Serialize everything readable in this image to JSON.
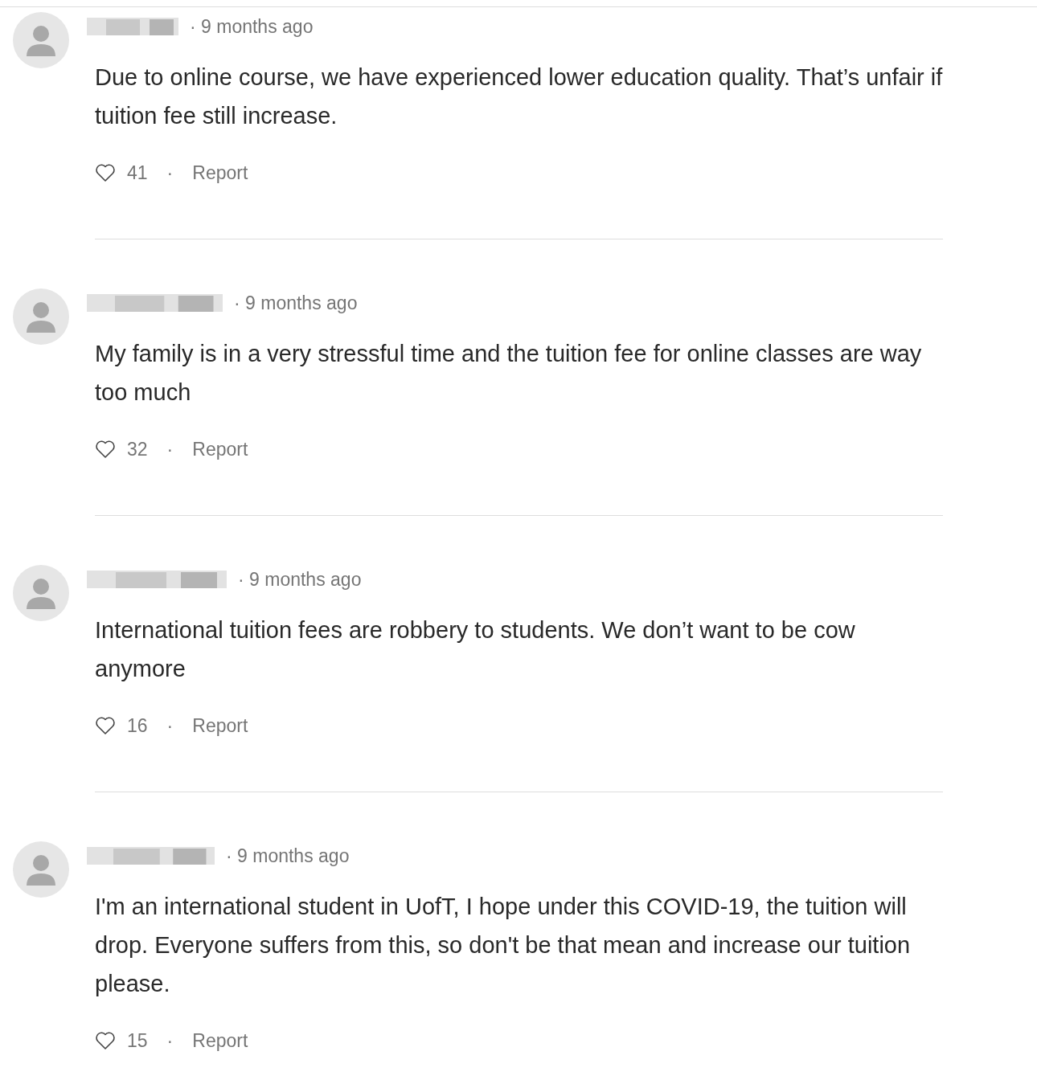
{
  "comments": [
    {
      "time": "· 9 months ago",
      "text": "Due to online course, we have experienced lower education quality. That’s unfair if tuition fee still increase.",
      "likes": "41",
      "separator": "·",
      "report": "Report"
    },
    {
      "time": "· 9 months ago",
      "text": "My family is in a very stressful time and the tuition fee for online classes are way too much",
      "likes": "32",
      "separator": "·",
      "report": "Report"
    },
    {
      "time": "· 9 months ago",
      "text": "International tuition fees are robbery to students. We don’t want to be cow anymore",
      "likes": "16",
      "separator": "·",
      "report": "Report"
    },
    {
      "time": "· 9 months ago",
      "text": "I'm an international student in UofT, I hope under this COVID-19, the tuition will drop. Everyone suffers from this, so don't be that mean and increase our tuition please.",
      "likes": "15",
      "separator": "·",
      "report": "Report"
    }
  ]
}
